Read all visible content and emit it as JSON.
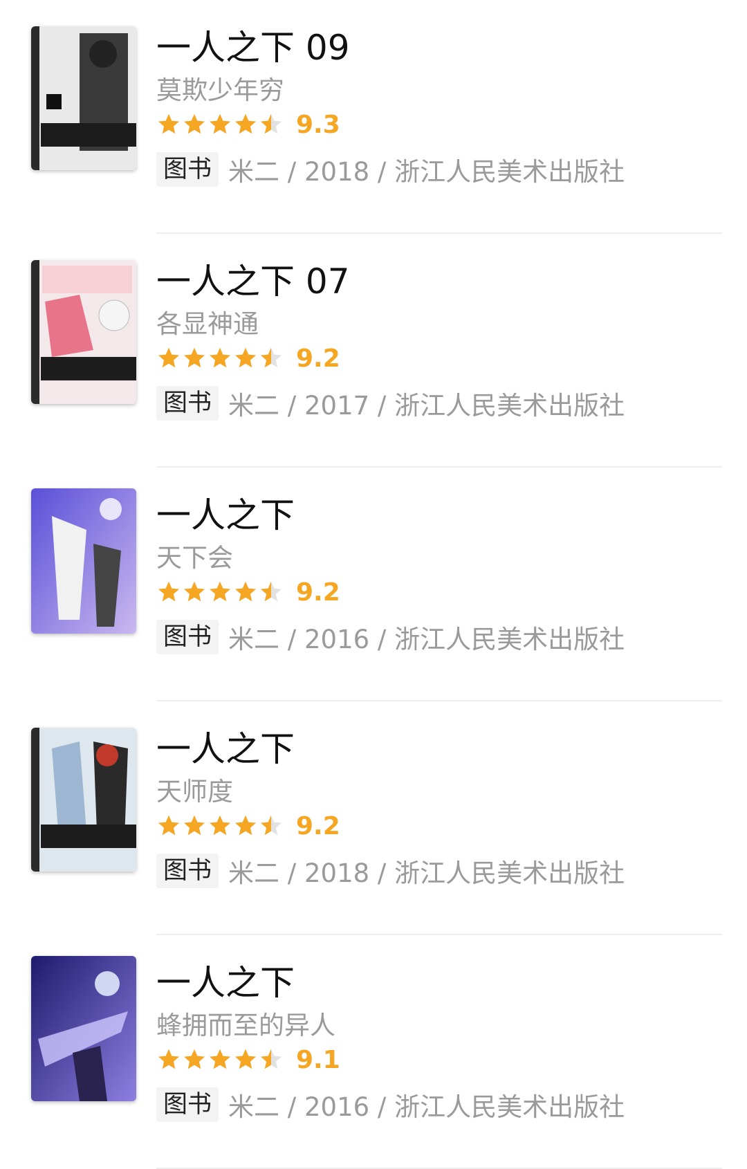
{
  "items": [
    {
      "title": "一人之下 09",
      "subtitle": "莫欺少年穷",
      "rating": 4.5,
      "score": "9.3",
      "tag": "图书",
      "meta": "米二 / 2018 / 浙江人民美术出版社"
    },
    {
      "title": "一人之下 07",
      "subtitle": "各显神通",
      "rating": 4.5,
      "score": "9.2",
      "tag": "图书",
      "meta": "米二 / 2017 / 浙江人民美术出版社"
    },
    {
      "title": "一人之下",
      "subtitle": "天下会",
      "rating": 4.5,
      "score": "9.2",
      "tag": "图书",
      "meta": "米二 / 2016 / 浙江人民美术出版社"
    },
    {
      "title": "一人之下",
      "subtitle": "天师度",
      "rating": 4.5,
      "score": "9.2",
      "tag": "图书",
      "meta": "米二 / 2018 / 浙江人民美术出版社"
    },
    {
      "title": "一人之下",
      "subtitle": "蜂拥而至的异人",
      "rating": 4.5,
      "score": "9.1",
      "tag": "图书",
      "meta": "米二 / 2016 / 浙江人民美术出版社"
    }
  ],
  "colors": {
    "star": "#f5a623",
    "score": "#f5a623",
    "muted": "#9a9a9a"
  }
}
